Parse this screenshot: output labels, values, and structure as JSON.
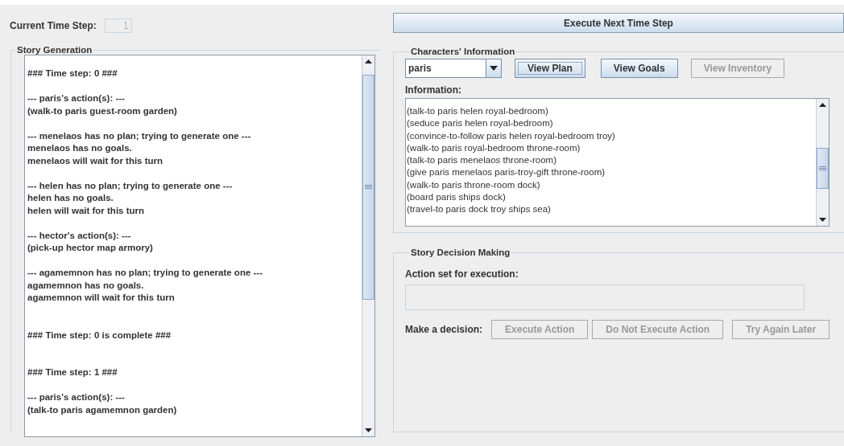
{
  "time_step": {
    "label": "Current Time Step:",
    "value": "1"
  },
  "execute_next_button": {
    "label": "Execute Next Time Step",
    "disabled": false
  },
  "story_generation": {
    "title": "Story Generation",
    "blocks": [
      {
        "kind": "marker",
        "lines": [
          "### Time step: 0 ###"
        ]
      },
      {
        "kind": "entry",
        "lines": [
          "--- paris's action(s): ---",
          "(walk-to paris guest-room garden)"
        ]
      },
      {
        "kind": "entry",
        "lines": [
          "--- menelaos has no plan; trying to generate one ---",
          "menelaos has no goals.",
          "menelaos will wait for this turn"
        ]
      },
      {
        "kind": "entry",
        "lines": [
          "--- helen has no plan; trying to generate one ---",
          "helen has no goals.",
          "helen will wait for this turn"
        ]
      },
      {
        "kind": "entry",
        "lines": [
          "--- hector's action(s): ---",
          "(pick-up hector map armory)"
        ]
      },
      {
        "kind": "entry",
        "lines": [
          "--- agamemnon has no plan; trying to generate one ---",
          "agamemnon has no goals.",
          "agamemnon will wait for this turn"
        ]
      },
      {
        "kind": "marker",
        "lines": [
          "### Time step: 0 is complete ###"
        ]
      },
      {
        "kind": "marker",
        "lines": [
          "### Time step: 1 ###"
        ]
      },
      {
        "kind": "entry",
        "lines": [
          "--- paris's action(s): ---",
          "(talk-to paris agamemnon garden)"
        ]
      }
    ]
  },
  "characters_information": {
    "title": "Characters' Information",
    "character": "paris",
    "buttons": [
      {
        "label": "View Plan",
        "disabled": false,
        "focused": true
      },
      {
        "label": "View Goals",
        "disabled": false,
        "focused": false
      },
      {
        "label": "View Inventory",
        "disabled": true,
        "focused": false
      }
    ],
    "information_label": "Information:",
    "information_lines": [
      "(talk-to paris helen royal-bedroom)",
      "(seduce paris helen royal-bedroom)",
      "(convince-to-follow paris helen royal-bedroom troy)",
      "(walk-to paris royal-bedroom throne-room)",
      "(talk-to paris menelaos throne-room)",
      "(give paris menelaos paris-troy-gift throne-room)",
      "(walk-to paris throne-room dock)",
      "(board paris ships dock)",
      "(travel-to paris dock troy ships sea)"
    ]
  },
  "story_decision_making": {
    "title": "Story Decision Making",
    "action_label": "Action set for execution:",
    "decision_label": "Make a decision:",
    "buttons": [
      {
        "label": "Execute Action",
        "disabled": true
      },
      {
        "label": "Do Not Execute Action",
        "disabled": true
      },
      {
        "label": "Try Again Later",
        "disabled": true
      }
    ]
  }
}
